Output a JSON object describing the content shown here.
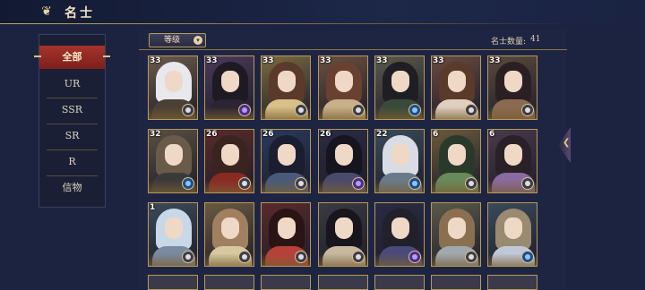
{
  "header": {
    "title": "名士",
    "back_icon": "return-swirl-icon"
  },
  "menu": {
    "items": [
      {
        "label": "全部",
        "active": true
      },
      {
        "label": "UR",
        "active": false
      },
      {
        "label": "SSR",
        "active": false
      },
      {
        "label": "SR",
        "active": false
      },
      {
        "label": "R",
        "active": false
      },
      {
        "label": "信物",
        "active": false
      }
    ]
  },
  "toolbar": {
    "sort_label": "等级",
    "count_label": "名士数量:",
    "count_value": "41"
  },
  "colors": {
    "accent_red": "#a5342c",
    "gold_border": "#b8985a",
    "panel_bg": "#1e2542"
  },
  "cards": [
    {
      "level": "33",
      "badge": "gray"
    },
    {
      "level": "33",
      "badge": "purple"
    },
    {
      "level": "33",
      "badge": "gray"
    },
    {
      "level": "33",
      "badge": "gray"
    },
    {
      "level": "33",
      "badge": "blue"
    },
    {
      "level": "33",
      "badge": "gray"
    },
    {
      "level": "33",
      "badge": "gray"
    },
    {
      "level": "32",
      "badge": "blue"
    },
    {
      "level": "26",
      "badge": "gray"
    },
    {
      "level": "26",
      "badge": "gray"
    },
    {
      "level": "26",
      "badge": "purple"
    },
    {
      "level": "22",
      "badge": "blue"
    },
    {
      "level": "6",
      "badge": "gray"
    },
    {
      "level": "6",
      "badge": "gray"
    },
    {
      "level": "1",
      "badge": "gray"
    },
    {
      "level": "",
      "badge": "gray"
    },
    {
      "level": "",
      "badge": "gray"
    },
    {
      "level": "",
      "badge": "gray"
    },
    {
      "level": "",
      "badge": "purple"
    },
    {
      "level": "",
      "badge": "gray"
    },
    {
      "level": "",
      "badge": "blue"
    }
  ]
}
